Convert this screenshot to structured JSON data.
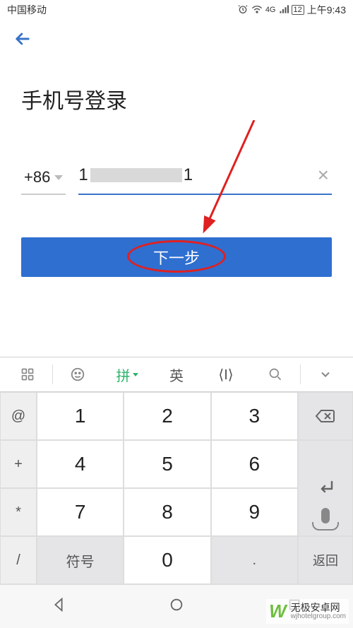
{
  "status": {
    "carrier": "中国移动",
    "network": "4G",
    "battery": "12",
    "time": "上午9:43"
  },
  "page": {
    "title": "手机号登录",
    "country_code": "+86",
    "phone_prefix": "1",
    "phone_suffix": "1",
    "next_button": "下一步"
  },
  "keyboard": {
    "top": {
      "pinyin": "拼",
      "english": "英",
      "clip": "⟨I⟩"
    },
    "side": [
      "@",
      "+",
      "*",
      "/"
    ],
    "main": [
      "1",
      "2",
      "3",
      "4",
      "5",
      "6",
      "7",
      "8",
      "9"
    ],
    "bottom": {
      "symbols": "符号",
      "zero": "0",
      "dot": "."
    },
    "right": {
      "return": "返回"
    }
  },
  "watermark": {
    "brand": "无极安卓网",
    "url": "wjhotelgroup.com"
  }
}
